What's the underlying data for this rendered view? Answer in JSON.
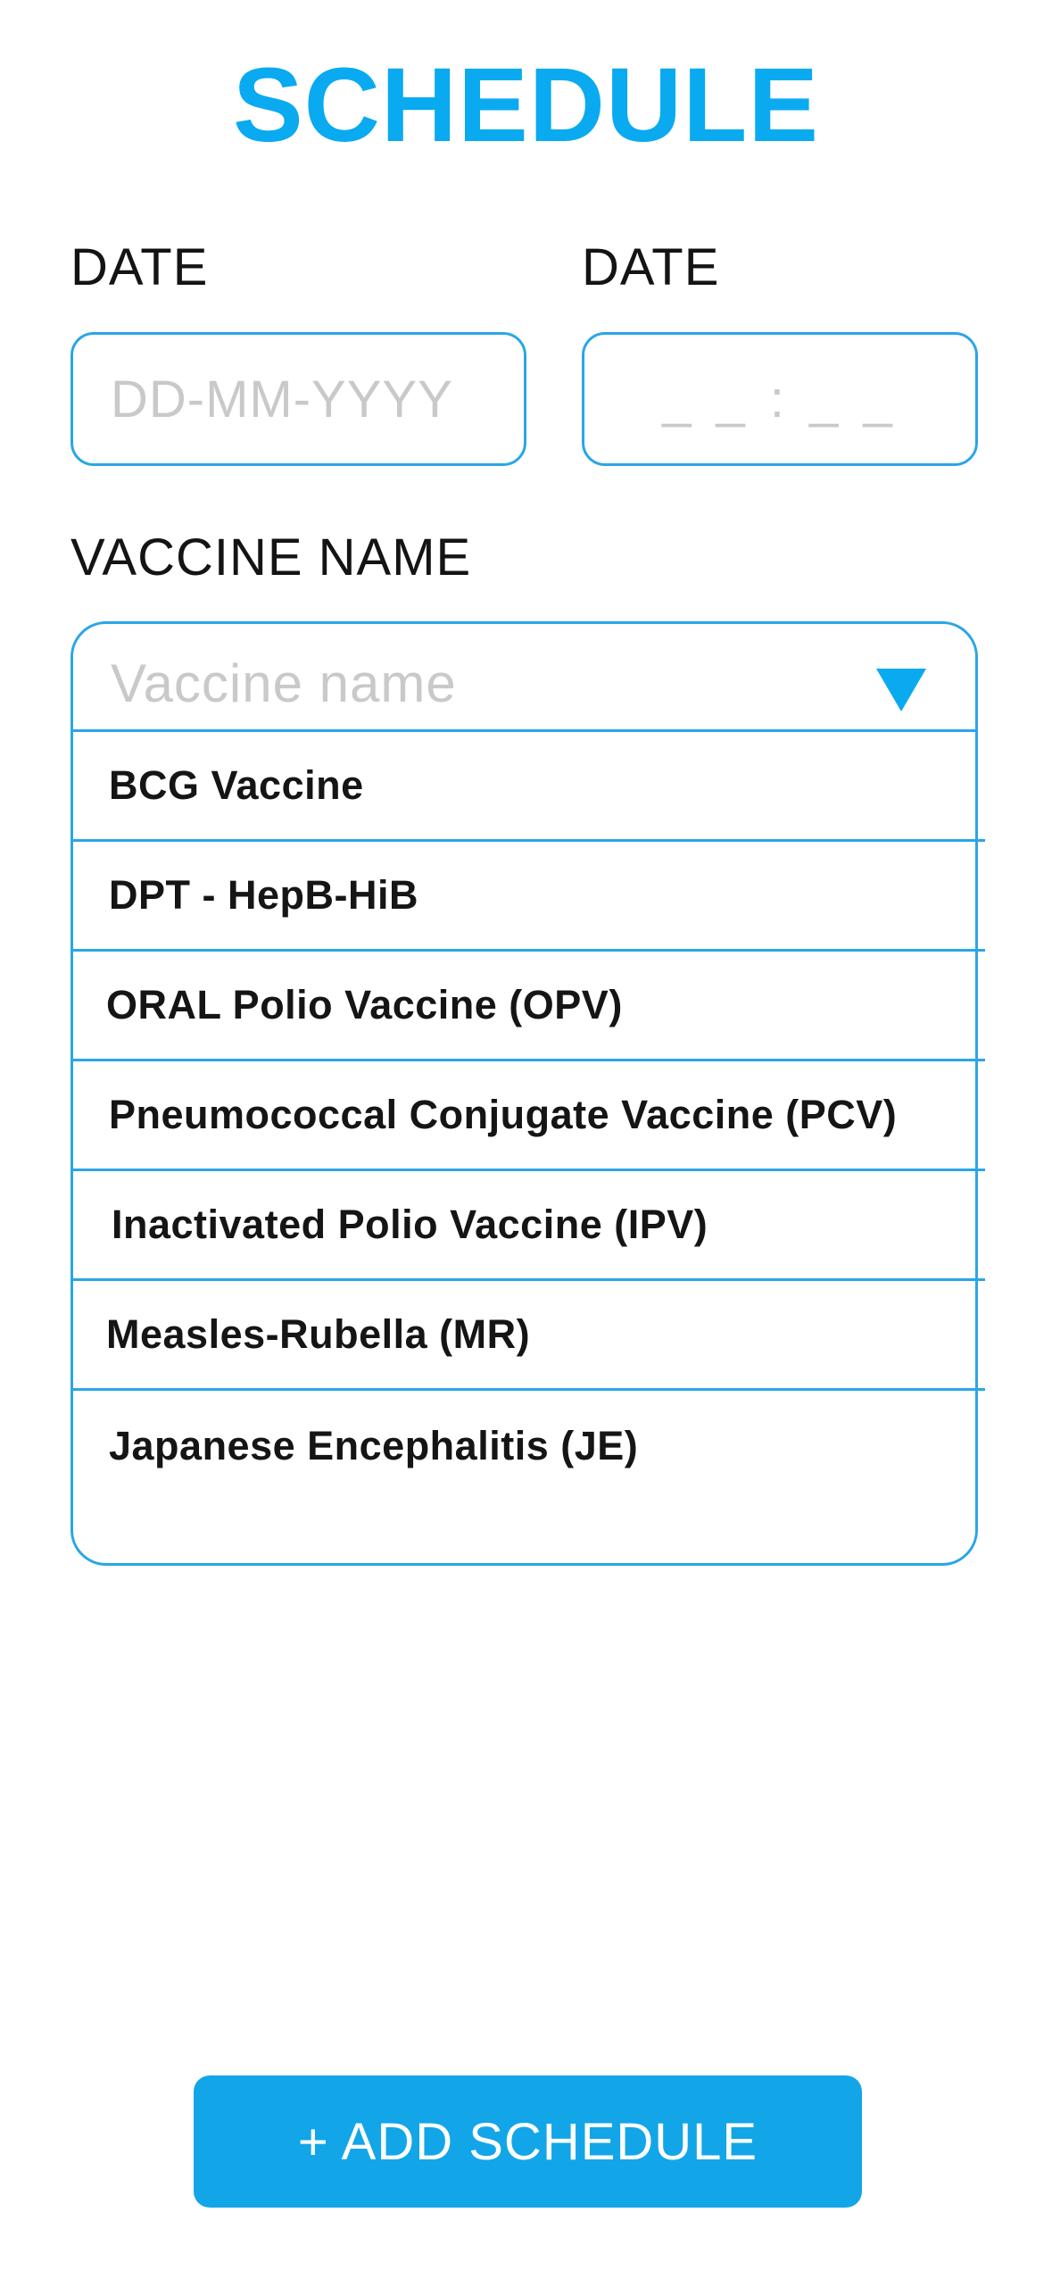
{
  "header": {
    "title": "SCHEDULE"
  },
  "form": {
    "date_label": "DATE",
    "date_placeholder": "DD-MM-YYYY",
    "time_label": "DATE",
    "time_placeholder": "_ _ : _ _",
    "vaccine_label": "VACCINE NAME",
    "vaccine_placeholder": "Vaccine name"
  },
  "dropdown": {
    "expanded": true,
    "caret_icon": "triangle-down-icon",
    "options": [
      "BCG Vaccine",
      "DPT - HepB-HiB",
      "ORAL Polio Vaccine (OPV)",
      "Pneumococcal Conjugate Vaccine (PCV)",
      "Inactivated Polio Vaccine (IPV)",
      "Measles-Rubella (MR)",
      "Japanese Encephalitis (JE)"
    ]
  },
  "actions": {
    "add_label": "+ ADD SCHEDULE"
  },
  "colors": {
    "accent": "#0AAAF0",
    "border": "#2AA6E6",
    "button": "#12A6E8",
    "placeholder": "#C9C9C9"
  }
}
